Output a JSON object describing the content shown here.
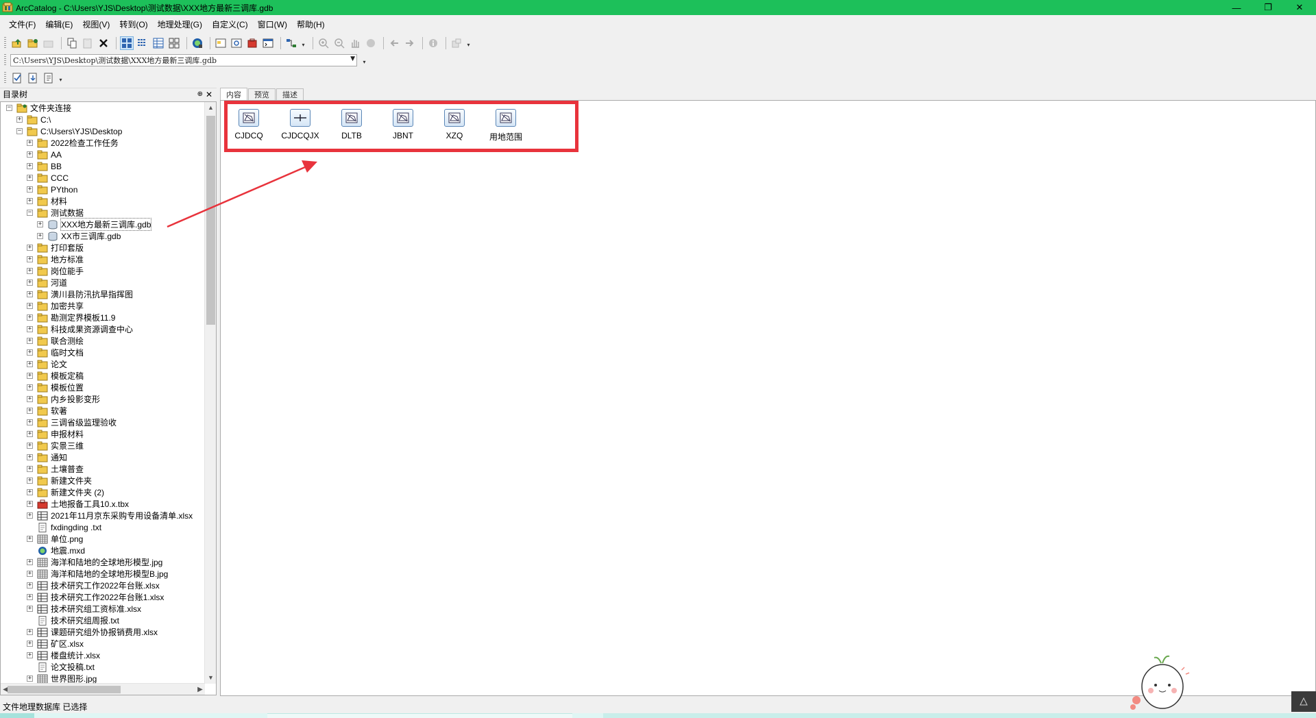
{
  "window": {
    "title": "ArcCatalog - C:\\Users\\YJS\\Desktop\\测试数据\\XXX地方最新三调库.gdb",
    "titlebar_color": "#1dc05a",
    "minimize": "—",
    "restore": "❐",
    "close": "✕"
  },
  "menu": {
    "items": [
      "文件(F)",
      "编辑(E)",
      "视图(V)",
      "转到(O)",
      "地理处理(G)",
      "自定义(C)",
      "窗口(W)",
      "帮助(H)"
    ]
  },
  "toolbar": {
    "icons": [
      "up-one-level-icon",
      "connect-folder-icon",
      "disconnect-folder-icon",
      "copy-icon",
      "paste-icon",
      "delete-icon",
      "large-icons-view-icon",
      "list-view-icon",
      "details-view-icon",
      "thumbnails-view-icon",
      "launch-arcmap-icon",
      "catalog-tree-icon",
      "search-window-icon",
      "arctoolbox-icon",
      "python-window-icon",
      "model-builder-icon",
      "zoom-in-icon",
      "zoom-out-icon",
      "pan-icon",
      "full-extent-icon",
      "back-icon",
      "forward-icon",
      "identify-icon",
      "create-thumbnail-icon"
    ]
  },
  "location": {
    "value": "C:\\Users\\YJS\\Desktop\\测试数据\\XXX地方最新三调库.gdb"
  },
  "catalog_tree": {
    "title": "目录树",
    "pin": "⊕",
    "close": "✕",
    "rows": [
      {
        "label": "文件夹连接",
        "level": 0,
        "expander": "−",
        "icon": "folder-connections"
      },
      {
        "label": "C:\\",
        "level": 1,
        "expander": "+",
        "icon": "folder"
      },
      {
        "label": "C:\\Users\\YJS\\Desktop",
        "level": 1,
        "expander": "−",
        "icon": "folder"
      },
      {
        "label": "2022检查工作任务",
        "level": 2,
        "expander": "+",
        "icon": "folder"
      },
      {
        "label": "AA",
        "level": 2,
        "expander": "+",
        "icon": "folder"
      },
      {
        "label": "BB",
        "level": 2,
        "expander": "+",
        "icon": "folder"
      },
      {
        "label": "CCC",
        "level": 2,
        "expander": "+",
        "icon": "folder"
      },
      {
        "label": "PYthon",
        "level": 2,
        "expander": "+",
        "icon": "folder"
      },
      {
        "label": "材料",
        "level": 2,
        "expander": "+",
        "icon": "folder"
      },
      {
        "label": "测试数据",
        "level": 2,
        "expander": "−",
        "icon": "folder"
      },
      {
        "label": "XXX地方最新三调库.gdb",
        "level": 3,
        "expander": "+",
        "icon": "gdb",
        "selected": true
      },
      {
        "label": "XX市三调库.gdb",
        "level": 3,
        "expander": "+",
        "icon": "gdb"
      },
      {
        "label": "打印套版",
        "level": 2,
        "expander": "+",
        "icon": "folder"
      },
      {
        "label": "地方标准",
        "level": 2,
        "expander": "+",
        "icon": "folder"
      },
      {
        "label": "岗位能手",
        "level": 2,
        "expander": "+",
        "icon": "folder"
      },
      {
        "label": "河道",
        "level": 2,
        "expander": "+",
        "icon": "folder"
      },
      {
        "label": "潢川县防汛抗旱指挥图",
        "level": 2,
        "expander": "+",
        "icon": "folder"
      },
      {
        "label": "加密共享",
        "level": 2,
        "expander": "+",
        "icon": "folder"
      },
      {
        "label": "勘测定界模板11.9",
        "level": 2,
        "expander": "+",
        "icon": "folder"
      },
      {
        "label": "科技成果资源调查中心",
        "level": 2,
        "expander": "+",
        "icon": "folder"
      },
      {
        "label": "联合测绘",
        "level": 2,
        "expander": "+",
        "icon": "folder"
      },
      {
        "label": "临时文档",
        "level": 2,
        "expander": "+",
        "icon": "folder"
      },
      {
        "label": "论文",
        "level": 2,
        "expander": "+",
        "icon": "folder"
      },
      {
        "label": "模板定稿",
        "level": 2,
        "expander": "+",
        "icon": "folder"
      },
      {
        "label": "模板位置",
        "level": 2,
        "expander": "+",
        "icon": "folder"
      },
      {
        "label": "内乡投影变形",
        "level": 2,
        "expander": "+",
        "icon": "folder"
      },
      {
        "label": "软著",
        "level": 2,
        "expander": "+",
        "icon": "folder"
      },
      {
        "label": "三调省级监理验收",
        "level": 2,
        "expander": "+",
        "icon": "folder"
      },
      {
        "label": "申报材料",
        "level": 2,
        "expander": "+",
        "icon": "folder"
      },
      {
        "label": "实景三维",
        "level": 2,
        "expander": "+",
        "icon": "folder"
      },
      {
        "label": "通知",
        "level": 2,
        "expander": "+",
        "icon": "folder"
      },
      {
        "label": "土壤普查",
        "level": 2,
        "expander": "+",
        "icon": "folder"
      },
      {
        "label": "新建文件夹",
        "level": 2,
        "expander": "+",
        "icon": "folder"
      },
      {
        "label": "新建文件夹 (2)",
        "level": 2,
        "expander": "+",
        "icon": "folder"
      },
      {
        "label": "土地报备工具10.x.tbx",
        "level": 2,
        "expander": "+",
        "icon": "toolbox"
      },
      {
        "label": "2021年11月京东采购专用设备清单.xlsx",
        "level": 2,
        "expander": "+",
        "icon": "table"
      },
      {
        "label": "fxdingding .txt",
        "level": 2,
        "expander": "",
        "icon": "text"
      },
      {
        "label": "单位.png",
        "level": 2,
        "expander": "+",
        "icon": "raster"
      },
      {
        "label": "地震.mxd",
        "level": 2,
        "expander": "",
        "icon": "mxd"
      },
      {
        "label": "海洋和陆地的全球地形模型.jpg",
        "level": 2,
        "expander": "+",
        "icon": "raster"
      },
      {
        "label": "海洋和陆地的全球地形模型B.jpg",
        "level": 2,
        "expander": "+",
        "icon": "raster"
      },
      {
        "label": "技术研究工作2022年台账.xlsx",
        "level": 2,
        "expander": "+",
        "icon": "table"
      },
      {
        "label": "技术研究工作2022年台账1.xlsx",
        "level": 2,
        "expander": "+",
        "icon": "table"
      },
      {
        "label": "技术研究组工资标准.xlsx",
        "level": 2,
        "expander": "+",
        "icon": "table"
      },
      {
        "label": "技术研究组周报.txt",
        "level": 2,
        "expander": "",
        "icon": "text"
      },
      {
        "label": "课题研究组外协报销费用.xlsx",
        "level": 2,
        "expander": "+",
        "icon": "table"
      },
      {
        "label": "矿区.xlsx",
        "level": 2,
        "expander": "+",
        "icon": "table"
      },
      {
        "label": "楼盘统计.xlsx",
        "level": 2,
        "expander": "+",
        "icon": "table"
      },
      {
        "label": "论文投稿.txt",
        "level": 2,
        "expander": "",
        "icon": "text"
      },
      {
        "label": "世界图形.jpg",
        "level": 2,
        "expander": "+",
        "icon": "raster"
      }
    ]
  },
  "tabs": [
    {
      "label": "内容",
      "active": true
    },
    {
      "label": "预览",
      "active": false
    },
    {
      "label": "描述",
      "active": false
    }
  ],
  "contents": {
    "items": [
      {
        "label": "CJDCQ",
        "icon": "polygon-feature-class-icon"
      },
      {
        "label": "CJDCQJX",
        "icon": "line-feature-class-icon"
      },
      {
        "label": "DLTB",
        "icon": "polygon-feature-class-icon"
      },
      {
        "label": "JBNT",
        "icon": "polygon-feature-class-icon"
      },
      {
        "label": "XZQ",
        "icon": "polygon-feature-class-icon"
      },
      {
        "label": "用地范围",
        "icon": "polygon-feature-class-icon"
      }
    ],
    "highlight_color": "#e8333c"
  },
  "status": {
    "text": "文件地理数据库 已选择"
  }
}
